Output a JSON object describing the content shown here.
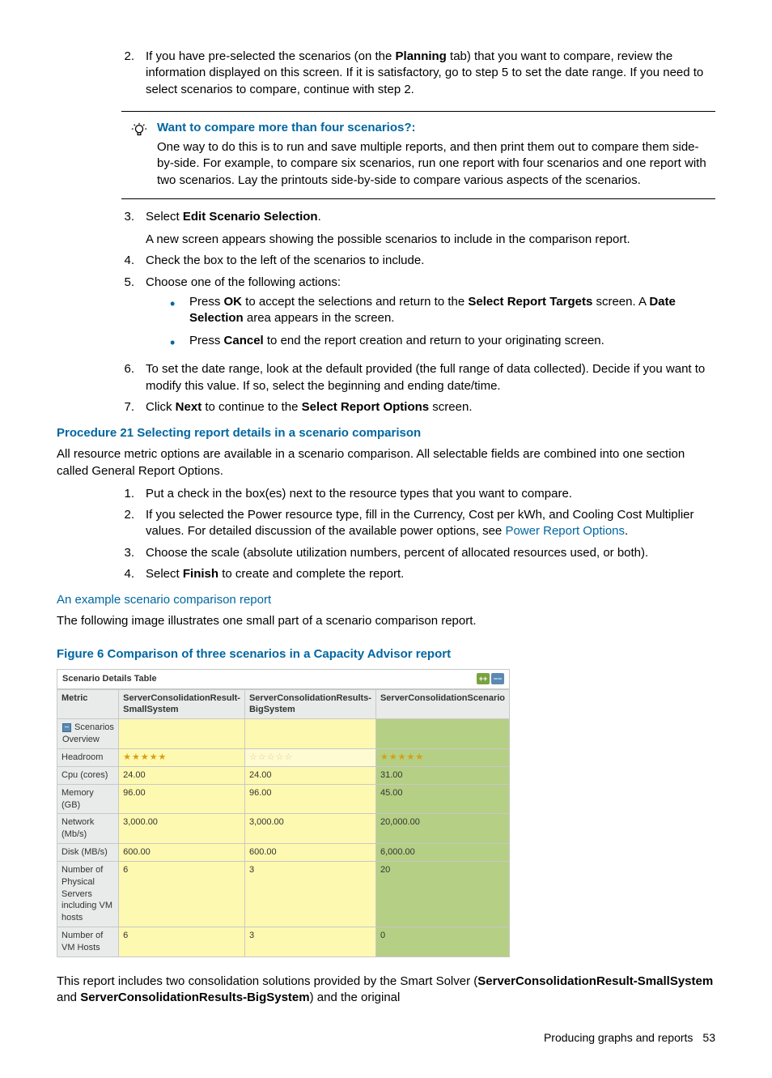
{
  "steps_a": {
    "n2": "2.",
    "s2": {
      "pre": "If you have pre-selected the scenarios (on the ",
      "b1": "Planning",
      "post": " tab) that you want to compare, review the information displayed on this screen. If it is satisfactory, go to step 5 to set the date range. If you need to select scenarios to compare, continue with step 2."
    }
  },
  "callout": {
    "title": "Want to compare more than four scenarios?:",
    "body": "One way to do this is to run and save multiple reports, and then print them out to compare them side-by-side. For example, to compare six scenarios, run one report with four scenarios and one report with two scenarios. Lay the printouts side-by-side to compare various aspects of the scenarios."
  },
  "steps_b": {
    "n3": "3.",
    "s3_pre": "Select ",
    "s3_b": "Edit Scenario Selection",
    "s3_post": ".",
    "s3_sub": "A new screen appears showing the possible scenarios to include in the comparison report.",
    "n4": "4.",
    "s4": "Check the box to the left of the scenarios to include.",
    "n5": "5.",
    "s5": "Choose one of the following actions:",
    "b1": {
      "pre": "Press ",
      "ok": "OK",
      "mid": " to accept the selections and return to the ",
      "srt": "Select Report Targets",
      "mid2": " screen. A ",
      "ds": "Date Selection",
      "post": " area appears in the screen."
    },
    "b2": {
      "pre": "Press ",
      "cancel": "Cancel",
      "post": " to end the report creation and return to your originating screen."
    },
    "n6": "6.",
    "s6": "To set the date range, look at the default provided (the full range of data collected). Decide if you want to modify this value. If so, select the beginning and ending date/time.",
    "n7": "7.",
    "s7_pre": "Click ",
    "s7_next": "Next",
    "s7_mid": " to continue to the ",
    "s7_sro": "Select Report Options",
    "s7_post": " screen."
  },
  "proc21": "Procedure 21 Selecting report details in a scenario comparison",
  "proc21_intro": "All resource metric options are available in a scenario comparison. All selectable fields are combined into one section called General Report Options.",
  "proc21_steps": {
    "n1": "1.",
    "s1": "Put a check in the box(es) next to the resource types that you want to compare.",
    "n2": "2.",
    "s2_pre": "If you selected the Power resource type, fill in the Currency, Cost per kWh, and Cooling Cost Multiplier values. For detailed discussion of the available power options, see ",
    "s2_link": "Power Report Options",
    "s2_post": ".",
    "n3": "3.",
    "s3": "Choose the scale (absolute utilization numbers, percent of allocated resources used, or both).",
    "n4": "4.",
    "s4_pre": "Select ",
    "s4_b": "Finish",
    "s4_post": "  to create and complete the report."
  },
  "example_heading": "An example scenario comparison report",
  "example_intro": "The following image illustrates one small part of a scenario comparison report.",
  "figure_title": "Figure 6 Comparison of three scenarios in a Capacity Advisor report",
  "table": {
    "header": "Scenario Details Table",
    "cols": {
      "metric": "Metric",
      "c1": "ServerConsolidationResult-SmallSystem",
      "c2": "ServerConsolidationResults-BigSystem",
      "c3": "ServerConsolidationScenario"
    },
    "section": "Scenarios Overview",
    "rows": [
      {
        "m": "Headroom",
        "v1": "★★★★★",
        "v2": "☆☆☆☆☆",
        "v3": "★★★★★"
      },
      {
        "m": "Cpu (cores)",
        "v1": "24.00",
        "v2": "24.00",
        "v3": "31.00"
      },
      {
        "m": "Memory (GB)",
        "v1": "96.00",
        "v2": "96.00",
        "v3": "45.00"
      },
      {
        "m": "Network (Mb/s)",
        "v1": "3,000.00",
        "v2": "3,000.00",
        "v3": "20,000.00"
      },
      {
        "m": "Disk (MB/s)",
        "v1": "600.00",
        "v2": "600.00",
        "v3": "6,000.00"
      },
      {
        "m": "Number of Physical Servers including VM hosts",
        "v1": "6",
        "v2": "3",
        "v3": "20"
      },
      {
        "m": "Number of VM Hosts",
        "v1": "6",
        "v2": "3",
        "v3": "0"
      }
    ]
  },
  "chart_data": {
    "type": "table",
    "title": "Scenario Details Table",
    "columns": [
      "Metric",
      "ServerConsolidationResult-SmallSystem",
      "ServerConsolidationResults-BigSystem",
      "ServerConsolidationScenario"
    ],
    "rows": [
      [
        "Headroom",
        5,
        0,
        5
      ],
      [
        "Cpu (cores)",
        24.0,
        24.0,
        31.0
      ],
      [
        "Memory (GB)",
        96.0,
        96.0,
        45.0
      ],
      [
        "Network (Mb/s)",
        3000.0,
        3000.0,
        20000.0
      ],
      [
        "Disk (MB/s)",
        600.0,
        600.0,
        6000.0
      ],
      [
        "Number of Physical Servers including VM hosts",
        6,
        3,
        20
      ],
      [
        "Number of VM Hosts",
        6,
        3,
        0
      ]
    ],
    "notes": "Headroom shown as star rating 0–5"
  },
  "after_figure": {
    "pre": "This report includes two consolidation solutions provided by the Smart Solver (",
    "b1": "ServerConsolidationResult-SmallSystem",
    "mid": " and ",
    "b2": "ServerConsolidationResults-BigSystem",
    "post": ") and the original"
  },
  "footer": {
    "section": "Producing graphs and reports",
    "page": "53"
  }
}
